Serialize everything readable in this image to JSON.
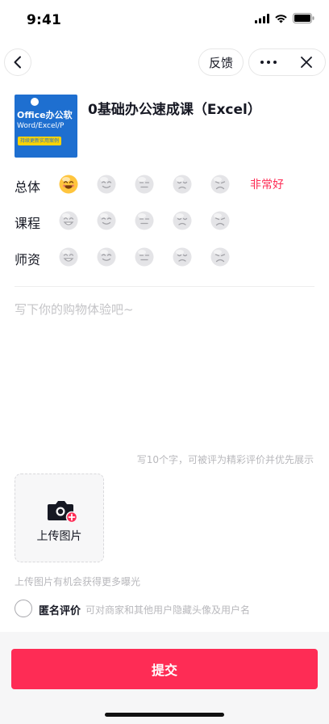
{
  "status_bar": {
    "time": "9:41"
  },
  "nav": {
    "feedback_label": "反馈"
  },
  "product": {
    "title": "0基础办公速成课（Excel）",
    "thumb_line1": "Office办公软",
    "thumb_line2": "Word/Excel/P",
    "thumb_tag": "持续更新实用案例"
  },
  "ratings": [
    {
      "label": "总体",
      "selected_index": 0,
      "selected_text": "非常好"
    },
    {
      "label": "课程",
      "selected_index": null,
      "selected_text": ""
    },
    {
      "label": "师资",
      "selected_index": null,
      "selected_text": ""
    }
  ],
  "review": {
    "placeholder": "写下你的购物体验吧~",
    "hint": "写10个字，可被评为精彩评价并优先展示"
  },
  "upload": {
    "label": "上传图片",
    "tip": "上传图片有机会获得更多曝光"
  },
  "anonymous": {
    "label": "匿名评价",
    "description": "可对商家和其他用户隐藏头像及用户名"
  },
  "submit_label": "提交",
  "colors": {
    "accent": "#fe2c55",
    "face_selected": "#ffc53d",
    "face_default": "#e4e4e7"
  }
}
